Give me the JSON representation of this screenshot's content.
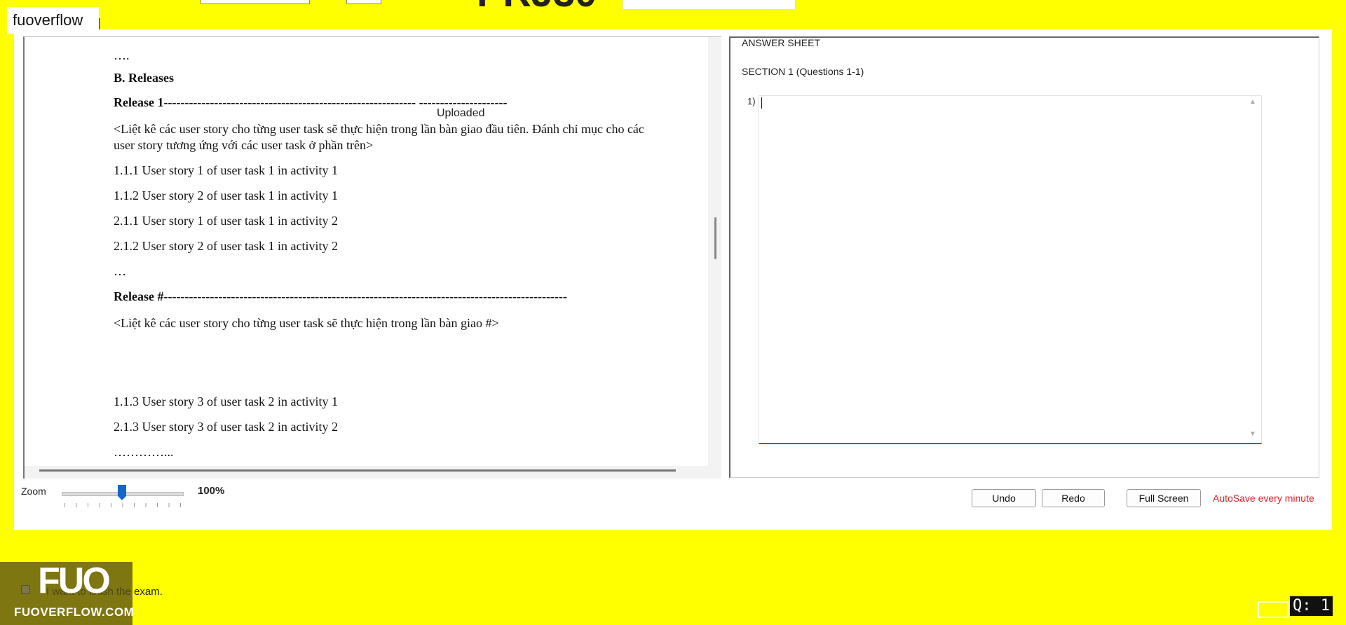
{
  "watermark": {
    "site": "fuoverflow",
    "logo_big": "FUO",
    "logo_text": "FUOVERFLOW.COM"
  },
  "header": {
    "cut_title": "PRJ30"
  },
  "document": {
    "lines": [
      "….",
      "B. Releases",
      "Release 1------------------------------------------------------------                     ---------------------",
      "<Liệt kê các user story cho từng user task sẽ thực hiện trong lần bàn giao đầu tiên. Đánh chỉ mục cho các",
      "user story tương ứng với các user task ở phần trên>",
      "1.1.1 User story 1 of user task 1 in activity 1",
      "1.1.2 User story 2 of user task 1 in activity 1",
      "2.1.1 User story 1 of user task 1 in activity 2",
      "2.1.2 User story 2 of user task 1 in activity 2",
      "…",
      "Release #------------------------------------------------------------------------------------------------",
      "<Liệt kê các user story cho từng user task sẽ thực hiện trong lần bàn giao #>",
      "1.1.3 User story 3 of user task 2 in activity 1",
      "2.1.3 User story 3 of user task 2 in activity 2",
      "…………..."
    ],
    "overlay_label": "Uploaded"
  },
  "zoom": {
    "label": "Zoom",
    "value": "100%",
    "level_fraction": 0.5
  },
  "answer_sheet": {
    "title": "ANSWER SHEET",
    "section": "SECTION 1 (Questions 1-1)",
    "question_number": "1)",
    "answer_text": ""
  },
  "toolbar": {
    "undo": "Undo",
    "redo": "Redo",
    "full_screen": "Full Screen",
    "autosave": "AutoSave every minute"
  },
  "footer": {
    "finish_label": "I want to finish the exam.",
    "question_badge": "Q: 1"
  },
  "icons": [
    "scroll-up-icon",
    "scroll-down-icon",
    "checkbox-icon"
  ],
  "colors": {
    "background": "#ffff00",
    "accent": "#1466c8",
    "autosave": "#e0202e"
  }
}
